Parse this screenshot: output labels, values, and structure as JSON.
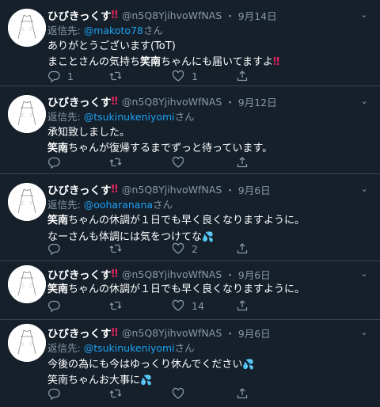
{
  "colors": {
    "background": "#15202b",
    "divider": "#38444d",
    "secondary_text": "#8899a6",
    "mention": "#1da1f2",
    "exclamation": "#e0245e"
  },
  "tweets": [
    {
      "name": "ひびきっくす",
      "name_mark": "‼",
      "handle": "@n5Q8YjihvoWfNAS",
      "dot": "・",
      "date": "9月14日",
      "reply_prefix": "返信先: ",
      "reply_to": "@makoto78",
      "reply_suffix": "さん",
      "line1": "ありがとうございます(ToT)",
      "line2_a": "まことさんの気持ち",
      "line2_b": "笑南",
      "line2_c": "ちゃんにも届いてますよ",
      "line2_mark": "‼",
      "reply_count": "1",
      "retweet_count": "",
      "like_count": "1"
    },
    {
      "name": "ひびきっくす",
      "name_mark": "‼",
      "handle": "@n5Q8YjihvoWfNAS",
      "dot": "・",
      "date": "9月12日",
      "reply_prefix": "返信先: ",
      "reply_to": "@tsukinukeniyomi",
      "reply_suffix": "さん",
      "line1": "承知致しました。",
      "line2_b": "笑南",
      "line2_c": "ちゃんが復帰するまでずっと待っています。",
      "reply_count": "",
      "retweet_count": "",
      "like_count": ""
    },
    {
      "name": "ひびきっくす",
      "name_mark": "‼",
      "handle": "@n5Q8YjihvoWfNAS",
      "dot": "・",
      "date": "9月6日",
      "reply_prefix": "返信先: ",
      "reply_to": "@ooharanana",
      "reply_suffix": "さん",
      "line1_b": "笑南",
      "line1_c": "ちゃんの休調が１日でも早く良くなりますように。",
      "line2": "なーさんも体調には気をつけてな",
      "line2_emoji": "💦",
      "reply_count": "",
      "retweet_count": "",
      "like_count": "2"
    },
    {
      "name": "ひびきっくす",
      "name_mark": "‼",
      "handle": "@n5Q8YjihvoWfNAS",
      "dot": "・",
      "date": "9月6日",
      "line1_b": "笑南",
      "line1_c": "ちゃんの休調が１日でも早く良くなりますように。",
      "reply_count": "",
      "retweet_count": "",
      "like_count": "14"
    },
    {
      "name": "ひびきっくす",
      "name_mark": "‼",
      "handle": "@n5Q8YjihvoWfNAS",
      "dot": "・",
      "date": "9月6日",
      "reply_prefix": "返信先: ",
      "reply_to": "@tsukinukeniyomi",
      "reply_suffix": "さん",
      "line1": "今後の為にも今はゆっくり休んでください",
      "line1_emoji": "💦",
      "line2": "笑南ちゃんお大事に",
      "line2_emoji": "💦",
      "reply_count": "",
      "retweet_count": "",
      "like_count": ""
    }
  ]
}
